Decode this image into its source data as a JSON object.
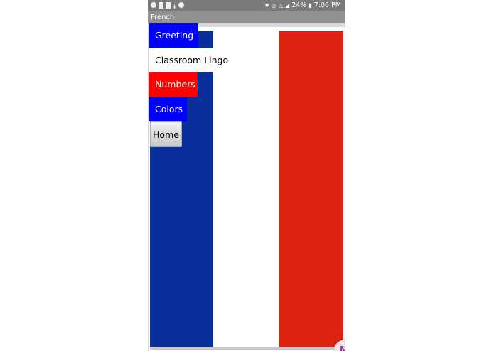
{
  "status_bar": {
    "battery_percent": "24%",
    "time": "7:06 PM",
    "left_icons": [
      "spotify-icon",
      "notification-icon",
      "clipboard-icon",
      "usb-icon",
      "camera-icon"
    ],
    "right_icons": [
      "bluetooth-icon",
      "alarm-icon",
      "wifi-icon",
      "signal-icon",
      "battery-icon"
    ]
  },
  "title_bar": {
    "title": "French"
  },
  "nav": {
    "greeting": "Greeting",
    "classroom": "Classroom Lingo",
    "numbers": "Numbers",
    "colors": "Colors",
    "home": "Home"
  },
  "colors": {
    "status_bar_bg": "#7a7a7a",
    "title_bar_bg": "#909090",
    "flag_blue": "#0a2f9a",
    "flag_white": "#ffffff",
    "flag_red": "#dd2212",
    "greeting_bg": "#0000ff",
    "classroom_bg": "#ffffff",
    "classroom_text": "#000000",
    "numbers_bg": "#ff0000",
    "colors_bg": "#0000ff",
    "home_bg": "#d6d6d6"
  },
  "floating_button": {
    "letter": "N",
    "icon": "onenote-icon"
  }
}
